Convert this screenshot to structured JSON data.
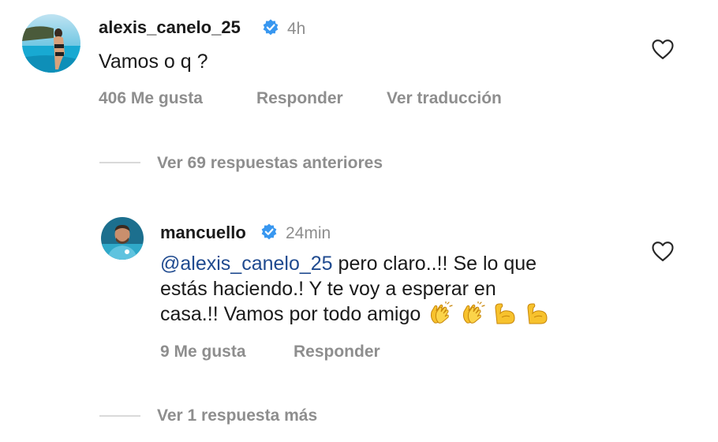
{
  "comments": [
    {
      "username": "alexis_canelo_25",
      "verified": true,
      "time": "4h",
      "text": "Vamos o q ?",
      "likes": "406 Me gusta",
      "reply_label": "Responder",
      "translate_label": "Ver traducción"
    }
  ],
  "view_previous": "Ver 69 respuestas anteriores",
  "reply": {
    "username": "mancuello",
    "verified": true,
    "time": "24min",
    "mention": "@alexis_canelo_25",
    "line1_rest": " pero claro..!! Se lo que",
    "line2": "estás haciendo.! Y te voy a esperar en",
    "line3": "casa.!! Vamos por todo amigo",
    "emojis": [
      "clapping-hands",
      "clapping-hands",
      "flexed-biceps",
      "flexed-biceps"
    ],
    "likes": "9 Me gusta",
    "reply_label": "Responder"
  },
  "view_more": "Ver 1 respuesta más",
  "colors": {
    "verified_badge": "#3897f0",
    "mention": "#1f4a8f",
    "secondary_text": "#8e8e8e"
  }
}
